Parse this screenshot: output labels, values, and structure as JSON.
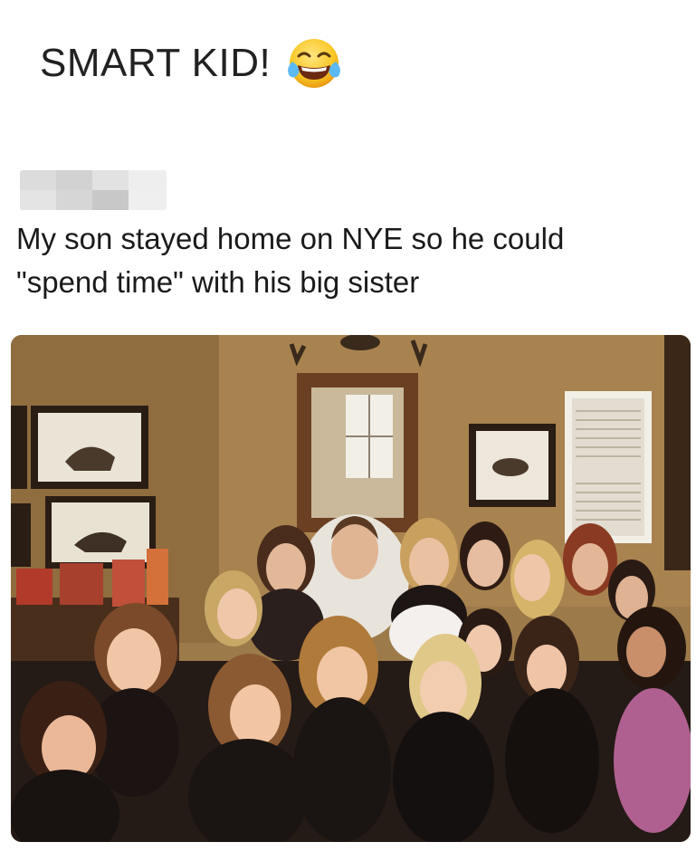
{
  "meme": {
    "caption": "SMART KID!",
    "caption_emoji": "face-with-tears-of-joy-icon"
  },
  "post": {
    "author_name": "",
    "text_line1": "My son stayed home on NYE so he could",
    "text_line2": "\"spend time\" with his big sister"
  },
  "photo": {
    "description_icon": "group-photo",
    "colors": {
      "wall": "#a07c4c",
      "frame": "#3b2418",
      "mirror": "#6b3f22",
      "shutter": "#f2efe7"
    }
  }
}
